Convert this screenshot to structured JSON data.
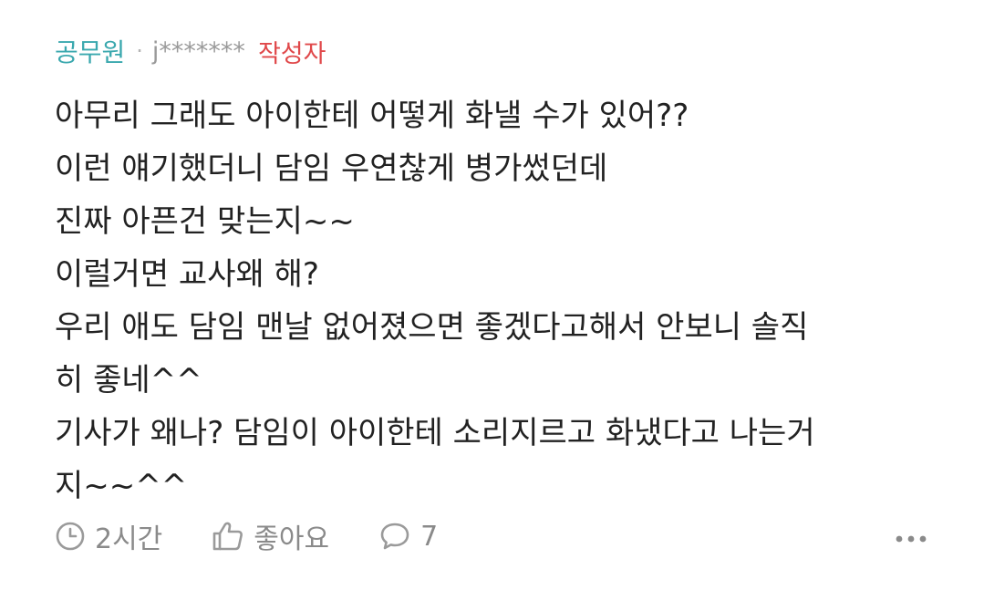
{
  "comment": {
    "author_type": "공무원",
    "separator": "·",
    "nickname": "j*******",
    "writer_badge": "작성자",
    "lines": [
      "아무리 그래도 아이한테 어떻게 화낼 수가 있어??",
      "이런 얘기했더니 담임 우연찮게 병가썼던데",
      "진짜 아픈건 맞는지~~",
      "이럴거면 교사왜 해?",
      "우리 애도 담임 맨날 없어졌으면 좋겠다고해서 안보니 솔직",
      "히 좋네^^",
      "기사가 왜나? 담임이 아이한테 소리지르고 화냈다고 나는거",
      "지~~^^"
    ]
  },
  "footer": {
    "time": "2시간",
    "like_label": "좋아요",
    "reply_count": "7",
    "icons": {
      "time": "clock-icon",
      "like": "thumbs-up-icon",
      "reply": "speech-bubble-icon",
      "more": "more-dots-icon"
    }
  },
  "colors": {
    "author_type": "#3aa8ae",
    "writer_badge": "#e0484a",
    "meta_gray": "#9a9a9a",
    "body_text": "#222222"
  }
}
